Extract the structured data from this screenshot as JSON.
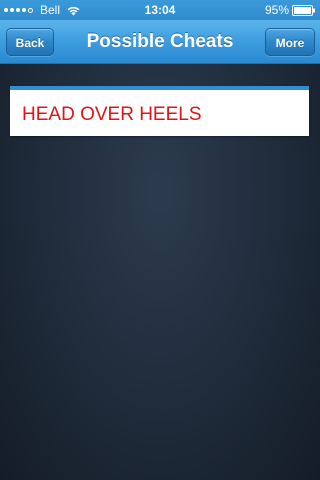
{
  "status_bar": {
    "carrier": "Bell",
    "time": "13:04",
    "battery_percent": "95%",
    "signal_strength": 4,
    "icons": [
      "signal-icon",
      "wifi-icon",
      "battery-icon"
    ]
  },
  "nav": {
    "title": "Possible Cheats",
    "back_label": "Back",
    "more_label": "More"
  },
  "items": [
    {
      "label": "HEAD OVER HEELS"
    }
  ],
  "colors": {
    "nav_blue": "#3d9ddf",
    "item_text_red": "#e01414",
    "background_dark": "#1f2b3a",
    "card_border_blue": "#2f8fd6"
  }
}
